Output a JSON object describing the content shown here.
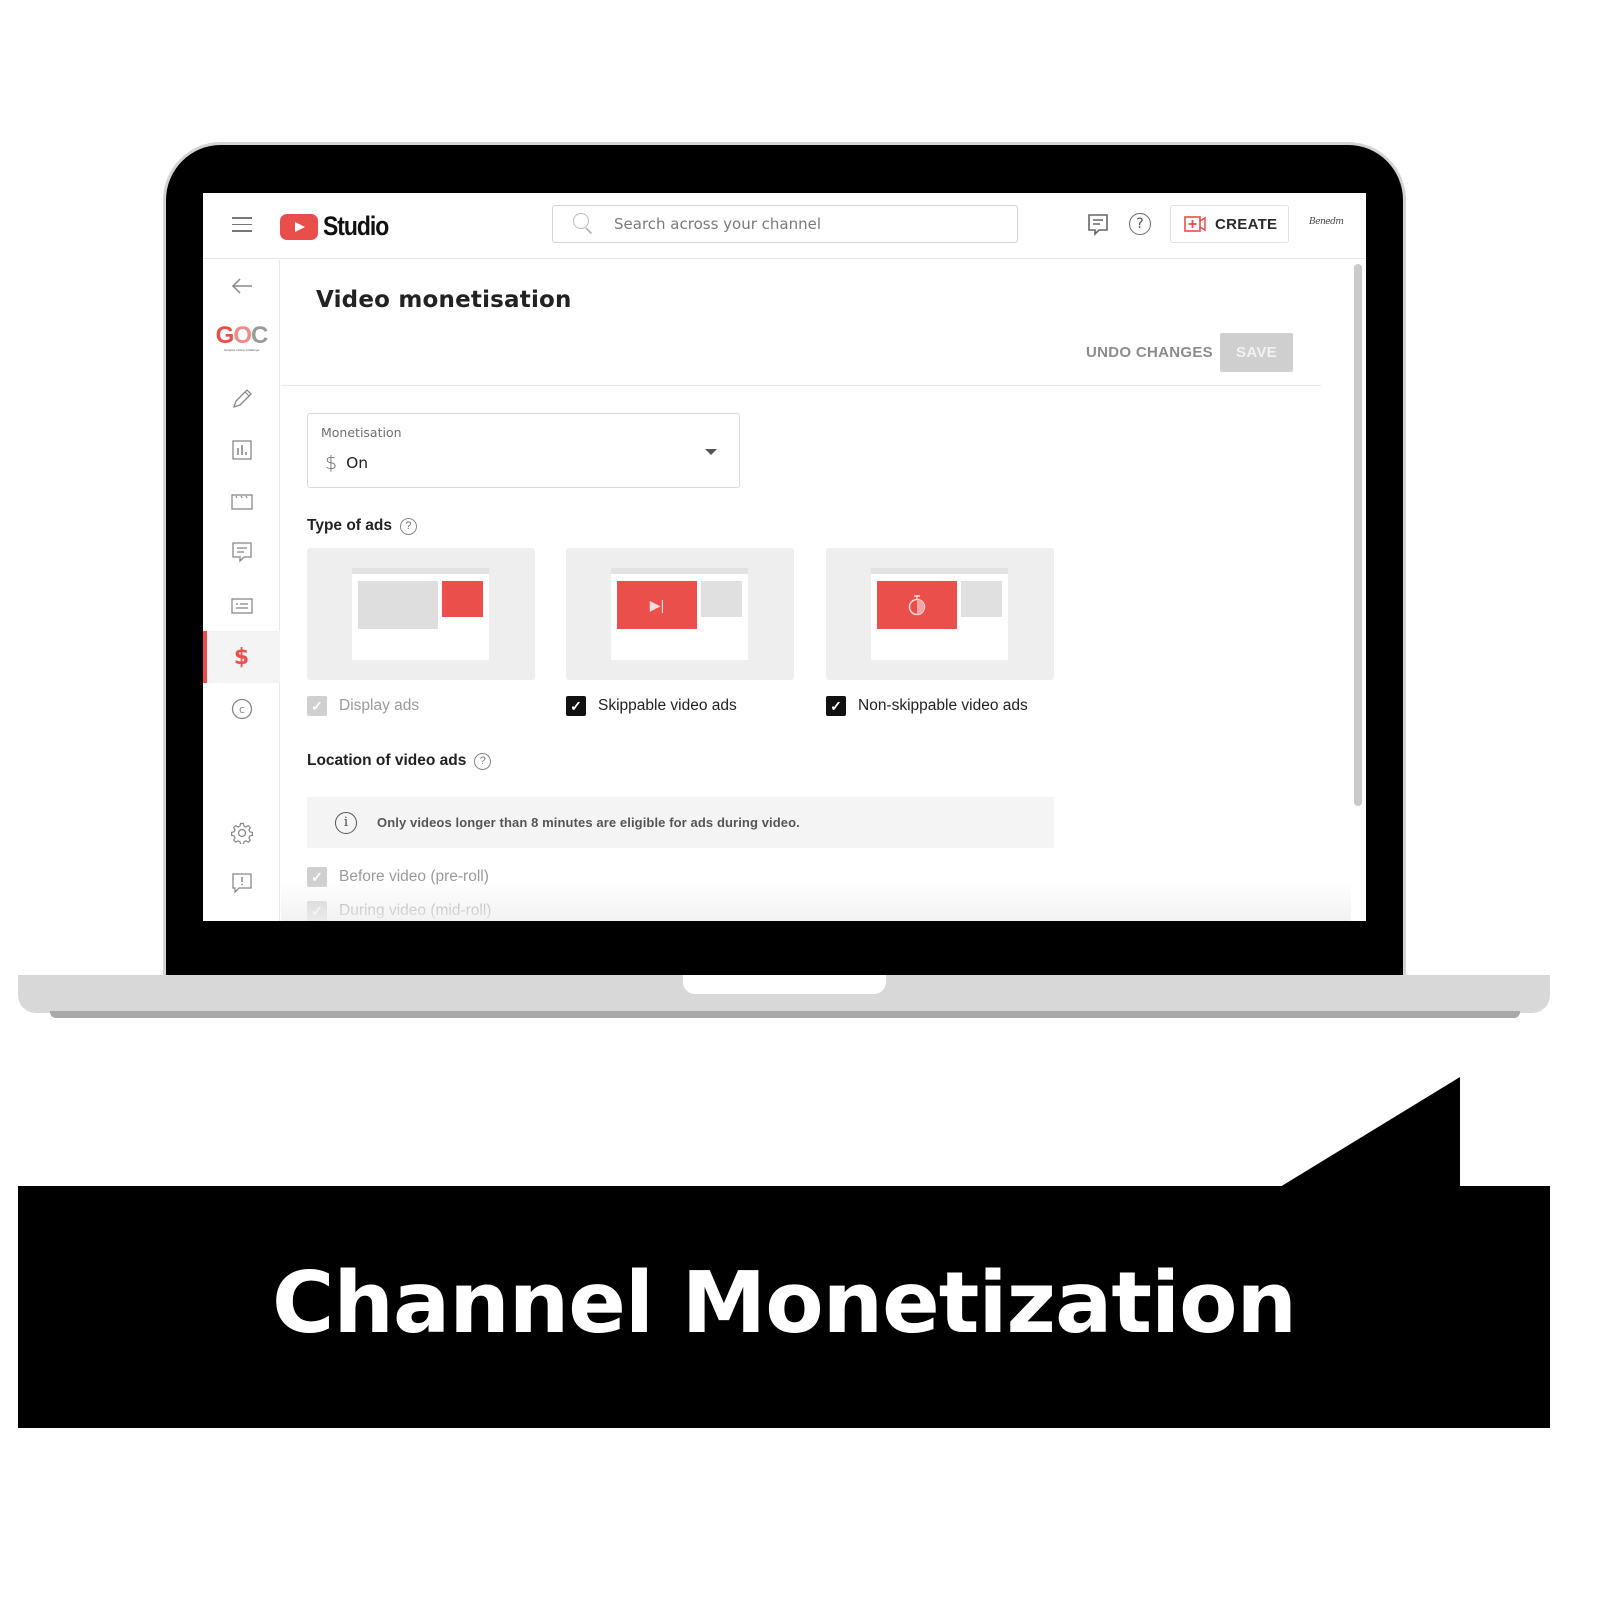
{
  "banner": {
    "title": "Channel Monetization"
  },
  "app": {
    "logo_text": "Studio",
    "search": {
      "placeholder": "Search across your channel"
    },
    "create_label": "CREATE",
    "account_signature": "Benedm",
    "icons": {
      "menu": "hamburger-icon",
      "feedback": "comment-icon",
      "help": "help-icon",
      "create": "video-plus-icon"
    }
  },
  "sidebar": {
    "channel_logo": {
      "letters": [
        "G",
        "O",
        "C"
      ],
      "tagline": "Google's Online Challenge"
    },
    "items": [
      {
        "name": "back",
        "icon": "arrow-left-icon",
        "glyph": "←"
      },
      {
        "name": "details",
        "icon": "pencil-icon",
        "glyph": "✎"
      },
      {
        "name": "analytics",
        "icon": "analytics-icon",
        "glyph": "📊"
      },
      {
        "name": "editor",
        "icon": "clapperboard-icon",
        "glyph": "🎬"
      },
      {
        "name": "comments",
        "icon": "comment-icon",
        "glyph": "💬"
      },
      {
        "name": "subtitles",
        "icon": "subtitles-icon",
        "glyph": "▭"
      },
      {
        "name": "monetisation",
        "icon": "dollar-icon",
        "glyph": "$",
        "active": true
      },
      {
        "name": "copyright",
        "icon": "copyright-icon",
        "glyph": "©"
      },
      {
        "name": "settings",
        "icon": "gear-icon",
        "glyph": "⚙"
      },
      {
        "name": "send-feedback",
        "icon": "feedback-icon",
        "glyph": "!"
      }
    ]
  },
  "page": {
    "title": "Video monetisation",
    "undo_label": "UNDO CHANGES",
    "save_label": "SAVE",
    "monetisation": {
      "label": "Monetisation",
      "value": "On",
      "icon": "dollar-icon"
    },
    "type_of_ads": {
      "title": "Type of ads",
      "options": [
        {
          "label": "Display ads",
          "checked": true,
          "disabled": true,
          "preview_icon": ""
        },
        {
          "label": "Skippable video ads",
          "checked": true,
          "disabled": false,
          "preview_icon": "skip-icon"
        },
        {
          "label": "Non-skippable video ads",
          "checked": true,
          "disabled": false,
          "preview_icon": "timer-icon"
        }
      ]
    },
    "location_of_ads": {
      "title": "Location of video ads",
      "info": "Only videos longer than 8 minutes are eligible for ads during video.",
      "options": [
        {
          "label": "Before video (pre-roll)",
          "checked": true,
          "disabled": true
        },
        {
          "label": "During video (mid-roll)",
          "checked": true,
          "disabled": true
        }
      ]
    }
  },
  "colors": {
    "accent": "#e94e4b",
    "banner": "#000000",
    "save_disabled": "#cfcfcf"
  }
}
